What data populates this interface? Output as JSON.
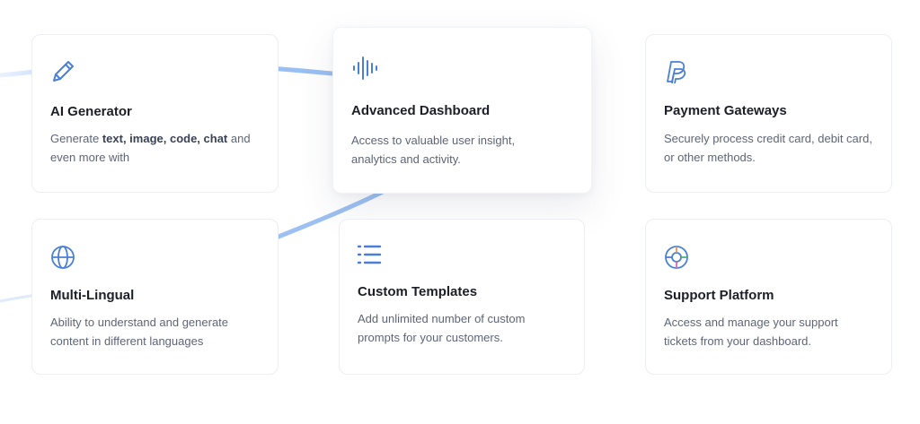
{
  "accent_color": "#4a7fd6",
  "cards": [
    {
      "icon": "pencil-icon",
      "title": "AI Generator",
      "desc_prefix": "Generate ",
      "desc_bold": "text, image, code, chat",
      "desc_suffix": " and even more with"
    },
    {
      "icon": "audio-waveform-icon",
      "title": "Advanced Dashboard",
      "desc": "Access to valuable user insight, analytics and activity."
    },
    {
      "icon": "paypal-icon",
      "title": "Payment Gateways",
      "desc": "Securely process credit card, debit card, or other methods."
    },
    {
      "icon": "globe-icon",
      "title": "Multi-Lingual",
      "desc": "Ability to understand and generate content in different languages"
    },
    {
      "icon": "list-icon",
      "title": "Custom Templates",
      "desc": "Add unlimited number of custom prompts for your customers."
    },
    {
      "icon": "lifebuoy-icon",
      "title": "Support Platform",
      "desc": "Access and manage your support tickets from your dashboard."
    }
  ]
}
